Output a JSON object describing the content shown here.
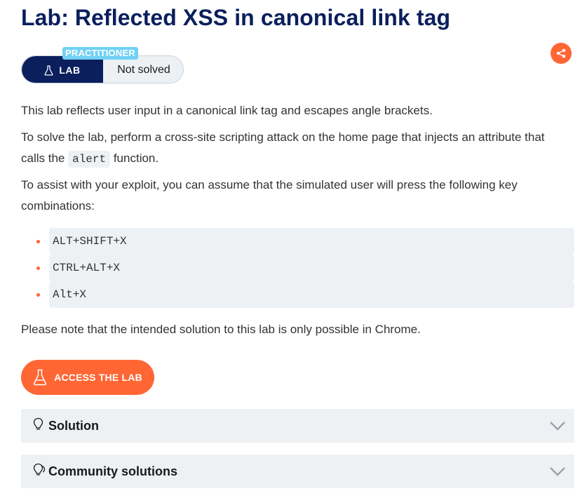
{
  "page": {
    "title": "Lab: Reflected XSS in canonical link tag"
  },
  "lab_badge": {
    "level": "PRACTITIONER",
    "type_label": "LAB",
    "status": "Not solved"
  },
  "description": {
    "intro": "This lab reflects user input in a canonical link tag and escapes angle brackets.",
    "solve_before": "To solve the lab, perform a cross-site scripting attack on the home page that injects an attribute that calls the ",
    "solve_code": "alert",
    "solve_after": " function.",
    "assist": "To assist with your exploit, you can assume that the simulated user will press the following key combinations:",
    "key_combinations": [
      "ALT+SHIFT+X",
      "CTRL+ALT+X",
      "Alt+X"
    ],
    "note": "Please note that the intended solution to this lab is only possible in Chrome."
  },
  "actions": {
    "access_lab_label": "ACCESS THE LAB"
  },
  "accordions": [
    {
      "title": "Solution",
      "icon": "lightbulb-icon"
    },
    {
      "title": "Community solutions",
      "icon": "speech-bubbles-icon"
    }
  ],
  "colors": {
    "title": "#0a1f5c",
    "accent": "#ff6633",
    "badge_dark": "#0a1f5c",
    "level_badge": "#70d1f4",
    "panel_bg": "#eef1f4"
  }
}
